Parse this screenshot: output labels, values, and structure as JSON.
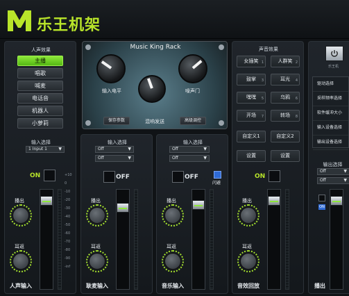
{
  "app": {
    "title": "乐王机架"
  },
  "rack": {
    "title": "Music King Rack",
    "knob_input": "输入电平",
    "knob_gate": "噪声门",
    "knob_mix": "混响发送",
    "btn_save": "保存参数",
    "btn_advanced": "高级调控"
  },
  "voice_fx": {
    "header": "人声效果",
    "items": [
      "主播",
      "唱歌",
      "喊麦",
      "电话音",
      "机器人",
      "小萝莉"
    ],
    "active_index": 0,
    "input_select_label": "输入选择",
    "input_value": "1 Input 1",
    "toggle": "ON",
    "monitor_label": "播出",
    "ear_label": "耳返",
    "channel_name": "人声输入"
  },
  "ch2": {
    "input_select_label": "输入选择",
    "dropdown1": "Off",
    "dropdown2": "Off",
    "toggle": "OFF",
    "monitor_label": "播出",
    "ear_label": "耳返",
    "channel_name": "耿麦输入"
  },
  "ch3": {
    "input_select_label": "输入选择",
    "dropdown1": "Off",
    "dropdown2": "Off",
    "toggle": "OFF",
    "flash_label": "闪避",
    "monitor_label": "播出",
    "ear_label": "耳返",
    "channel_name": "音乐输入"
  },
  "sound_fx": {
    "header": "声音效果",
    "items": [
      "女插笑",
      "人群笑",
      "鼓掌",
      "耳光",
      "嘿嘿",
      "乌鸦",
      "开场",
      "转场"
    ],
    "numbers": [
      "1",
      "2",
      "3",
      "4",
      "5",
      "6",
      "7",
      "8"
    ],
    "custom1": "自定义1",
    "custom2": "自定义2",
    "set1": "设置",
    "set2": "设置",
    "toggle": "ON",
    "monitor_label": "播出",
    "ear_label": "耳返",
    "channel_name": "音效回放"
  },
  "right": {
    "power_label": "乐王机",
    "menu": [
      "驱动选择",
      "采样频率选择",
      "软件缓冲大小",
      "输入设备选择",
      "输出设备选择"
    ],
    "output_select_label": "输出选择",
    "dropdown1": "Off",
    "dropdown2": "Off",
    "on_small": "ON",
    "monitor_label": "播出"
  },
  "scale": [
    "+10",
    "0",
    "-10",
    "-20",
    "-30",
    "-40",
    "-50",
    "-60",
    "-70",
    "-80",
    "-90",
    "-inf"
  ],
  "accent": "#8ee83a"
}
